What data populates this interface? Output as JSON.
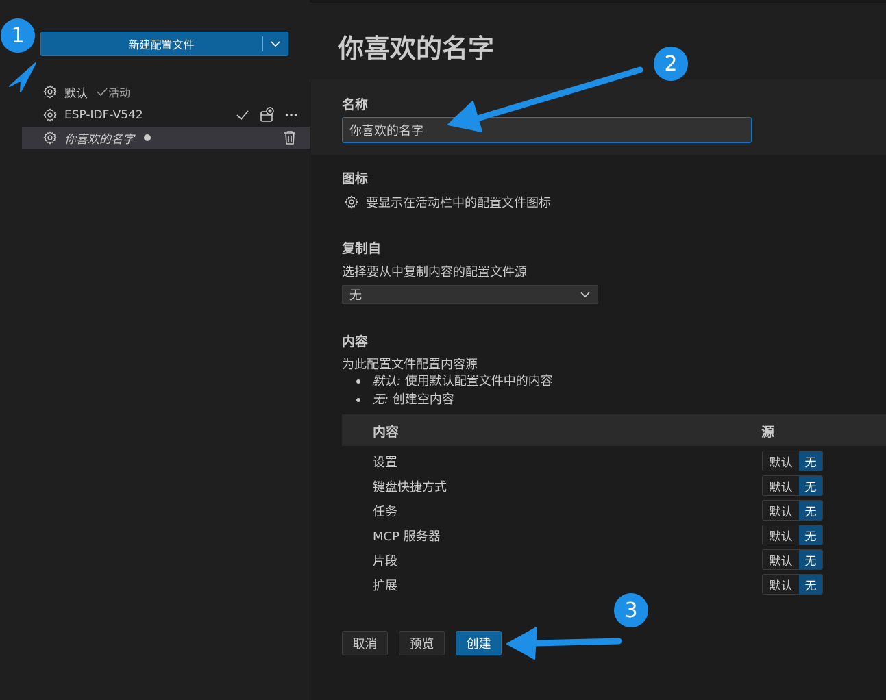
{
  "sidebar": {
    "new_profile_button": "新建配置文件",
    "profiles": [
      {
        "name": "默认",
        "status": "活动"
      },
      {
        "name": "ESP-IDF-V542"
      },
      {
        "name": "你喜欢的名字"
      }
    ]
  },
  "main": {
    "title": "你喜欢的名字",
    "name_section": {
      "heading": "名称",
      "value": "你喜欢的名字"
    },
    "icon_section": {
      "heading": "图标",
      "description": "要显示在活动栏中的配置文件图标"
    },
    "copy_section": {
      "heading": "复制自",
      "description": "选择要从中复制内容的配置文件源",
      "selected": "无"
    },
    "contents_section": {
      "heading": "内容",
      "description": "为此配置文件配置内容源",
      "bullets": [
        {
          "term": "默认:",
          "text": " 使用默认配置文件中的内容"
        },
        {
          "term": "无:",
          "text": " 创建空内容"
        }
      ],
      "table_headers": {
        "content": "内容",
        "source": "源"
      },
      "rows": [
        {
          "name": "设置",
          "option_a": "默认",
          "option_b": "无"
        },
        {
          "name": "键盘快捷方式",
          "option_a": "默认",
          "option_b": "无"
        },
        {
          "name": "任务",
          "option_a": "默认",
          "option_b": "无"
        },
        {
          "name": "MCP 服务器",
          "option_a": "默认",
          "option_b": "无"
        },
        {
          "name": "片段",
          "option_a": "默认",
          "option_b": "无"
        },
        {
          "name": "扩展",
          "option_a": "默认",
          "option_b": "无"
        }
      ]
    },
    "buttons": {
      "cancel": "取消",
      "preview": "预览",
      "create": "创建"
    }
  },
  "annotations": {
    "badge_1": "1",
    "badge_2": "2",
    "badge_3": "3"
  },
  "colors": {
    "accent": "#0e639c",
    "annotation": "#1e8fe6",
    "background": "#1f1f1f"
  }
}
